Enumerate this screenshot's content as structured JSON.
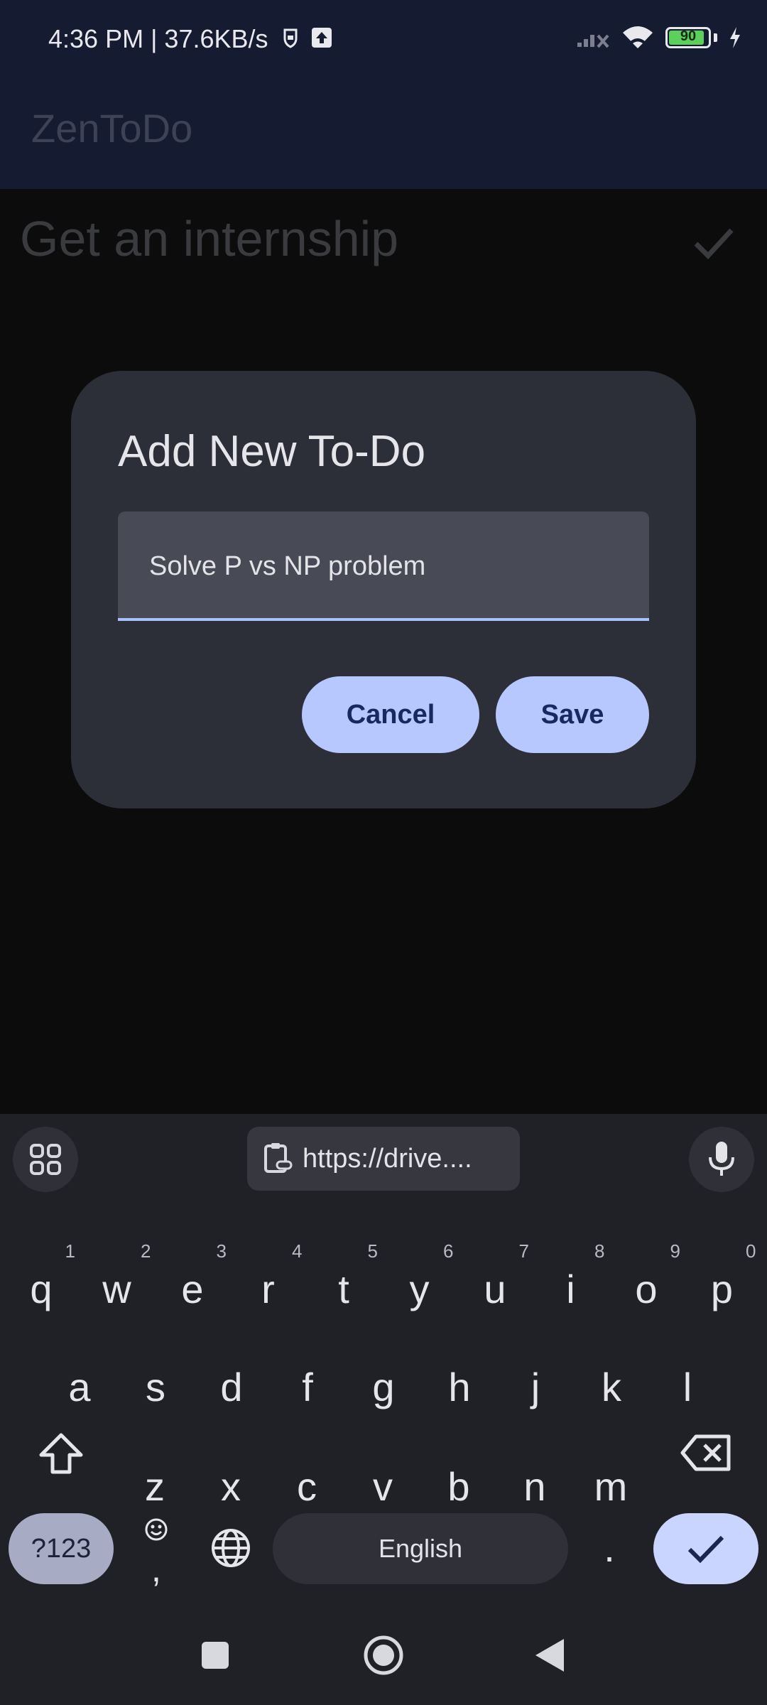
{
  "status_bar": {
    "time": "4:36 PM | 37.6KB/s",
    "battery": "90"
  },
  "app": {
    "title": "ZenToDo"
  },
  "todos": [
    {
      "text": "Get an internship"
    }
  ],
  "dialog": {
    "title": "Add New To-Do",
    "input_value": "Solve P vs NP problem",
    "cancel_label": "Cancel",
    "save_label": "Save"
  },
  "keyboard": {
    "clipboard_text": "https://drive....",
    "row1": [
      {
        "k": "q",
        "s": "1"
      },
      {
        "k": "w",
        "s": "2"
      },
      {
        "k": "e",
        "s": "3"
      },
      {
        "k": "r",
        "s": "4"
      },
      {
        "k": "t",
        "s": "5"
      },
      {
        "k": "y",
        "s": "6"
      },
      {
        "k": "u",
        "s": "7"
      },
      {
        "k": "i",
        "s": "8"
      },
      {
        "k": "o",
        "s": "9"
      },
      {
        "k": "p",
        "s": "0"
      }
    ],
    "row2": [
      "a",
      "s",
      "d",
      "f",
      "g",
      "h",
      "j",
      "k",
      "l"
    ],
    "row3": [
      "z",
      "x",
      "c",
      "v",
      "b",
      "n",
      "m"
    ],
    "symbols_label": "?123",
    "emoji_comma_label": ",",
    "space_label": "English",
    "period_label": "."
  },
  "colors": {
    "accent": "#b7c7ff",
    "accent_text": "#17295f",
    "dialog_bg": "#2d2f38"
  }
}
